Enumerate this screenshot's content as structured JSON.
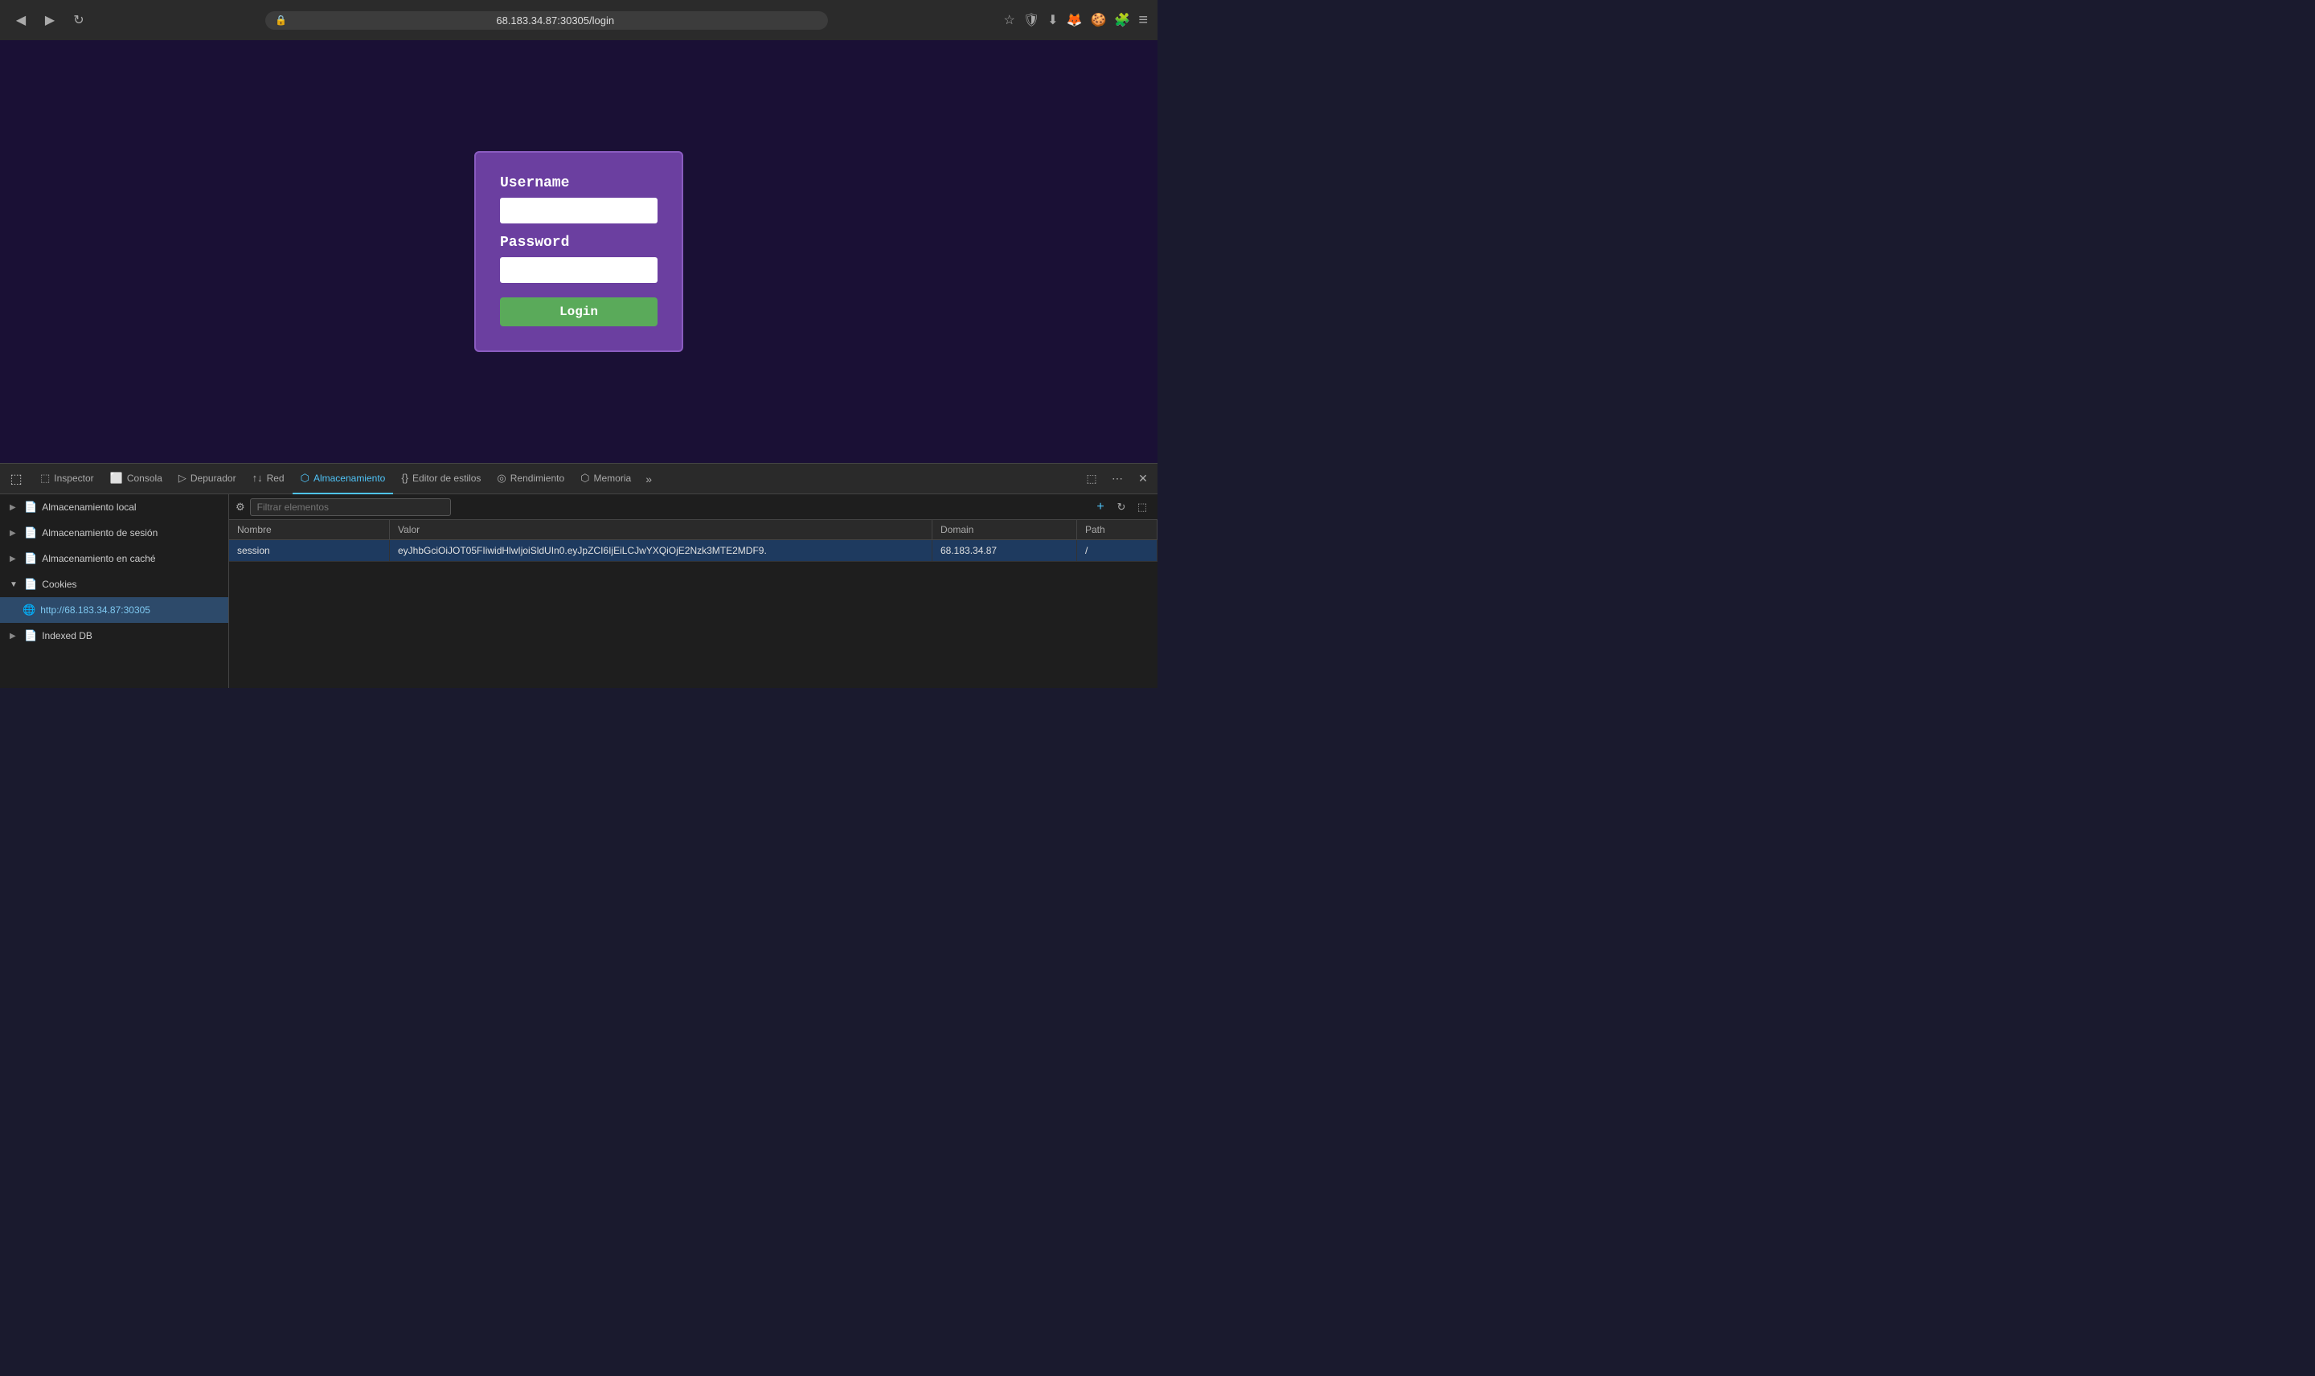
{
  "browser": {
    "back_label": "◀",
    "forward_label": "▶",
    "refresh_label": "↻",
    "url_prefix": "68.183.34.87",
    "url_path": ":30305/login",
    "bookmark_icon": "☆",
    "shield_icon": "🛡",
    "download_icon": "⬇",
    "extension1_icon": "🦊",
    "extension2_icon": "🍪",
    "extensions_icon": "🧩",
    "menu_icon": "≡"
  },
  "login_form": {
    "username_label": "Username",
    "password_label": "Password",
    "login_button": "Login",
    "username_placeholder": "",
    "password_placeholder": ""
  },
  "devtools": {
    "tabs": [
      {
        "id": "inspector",
        "label": "Inspector",
        "icon": "⬚"
      },
      {
        "id": "console",
        "label": "Consola",
        "icon": "⬜"
      },
      {
        "id": "debugger",
        "label": "Depurador",
        "icon": "▷"
      },
      {
        "id": "network",
        "label": "Red",
        "icon": "↑↓"
      },
      {
        "id": "storage",
        "label": "Almacenamiento",
        "icon": "⬡"
      },
      {
        "id": "style-editor",
        "label": "Editor de estilos",
        "icon": "{}"
      },
      {
        "id": "performance",
        "label": "Rendimiento",
        "icon": "◎"
      },
      {
        "id": "memory",
        "label": "Memoria",
        "icon": "⬡"
      }
    ],
    "active_tab": "storage",
    "more_label": "»",
    "sidebar": {
      "items": [
        {
          "id": "local-storage",
          "label": "Almacenamiento local",
          "icon": "📄",
          "expanded": false
        },
        {
          "id": "session-storage",
          "label": "Almacenamiento de sesión",
          "icon": "📄",
          "expanded": false
        },
        {
          "id": "cache-storage",
          "label": "Almacenamiento en caché",
          "icon": "📄",
          "expanded": false
        },
        {
          "id": "cookies",
          "label": "Cookies",
          "icon": "📄",
          "expanded": true
        },
        {
          "id": "cookies-url",
          "label": "http://68.183.34.87:30305",
          "icon": "🌐",
          "sub": true,
          "active": true
        },
        {
          "id": "indexeddb",
          "label": "Indexed DB",
          "icon": "📄",
          "expanded": false
        }
      ]
    },
    "filter_placeholder": "Filtrar elementos",
    "table": {
      "headers": [
        "Nombre",
        "Valor",
        "Domain",
        "Path"
      ],
      "rows": [
        {
          "name": "session",
          "value": "eyJhbGciOiJOT05FIiwidHlwIjoiSldUIn0.eyJpZCI6IjEiLCJwYXQiOjE2Nzk3MTE2MDF9.",
          "domain": "68.183.34.87",
          "path": "/",
          "selected": true
        }
      ]
    }
  }
}
